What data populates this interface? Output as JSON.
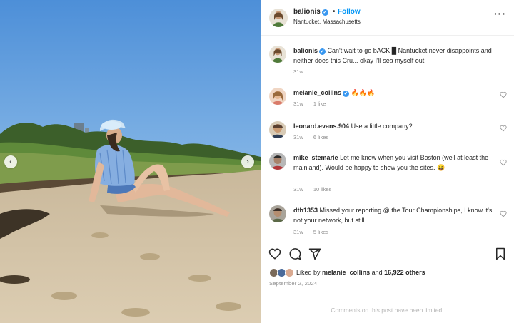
{
  "colors": {
    "accent": "#0095f6",
    "verified": "#3897f0",
    "muted": "#8e8e8e",
    "text": "#262626"
  },
  "photo": {
    "prev_icon": "chevron-left-icon",
    "next_icon": "chevron-right-icon",
    "prev_glyph": "‹",
    "next_glyph": "›"
  },
  "header": {
    "username": "balionis",
    "verified_glyph": "✓",
    "separator": "•",
    "follow_label": "Follow",
    "location": "Nantucket, Massachusetts",
    "more_glyph": "···"
  },
  "caption": {
    "username": "balionis",
    "text": "Can't wait to go bACK █ Nantucket never disappoints and neither does this Cru... okay I'll sea myself out.",
    "time": "31w"
  },
  "comments": [
    {
      "username": "melanie_collins",
      "verified": true,
      "text": "🔥🔥🔥",
      "time": "31w",
      "likes": "1 like"
    },
    {
      "username": "leonard.evans.904",
      "verified": false,
      "text": "Use a little company?",
      "time": "31w",
      "likes": "6 likes"
    },
    {
      "username": "mike_stemarie",
      "verified": false,
      "text": "Let me know when you visit Boston (well at least the mainland). Would be happy to show you the sites.",
      "emoji": "😄",
      "time": "31w",
      "likes": "10 likes"
    },
    {
      "username": "dth1353",
      "verified": false,
      "text": "Missed your reporting @ the Tour Championships, I know it's not your network, but still",
      "time": "31w",
      "likes": "5 likes"
    }
  ],
  "actions": {
    "like": "heart-icon",
    "comment": "comment-icon",
    "share": "share-icon",
    "save": "bookmark-icon"
  },
  "likes_summary": {
    "prefix": "Liked by",
    "user": "melanie_collins",
    "connector": "and",
    "others": "16,922 others"
  },
  "date": "September 2, 2024",
  "comments_limited": "Comments on this post have been limited."
}
